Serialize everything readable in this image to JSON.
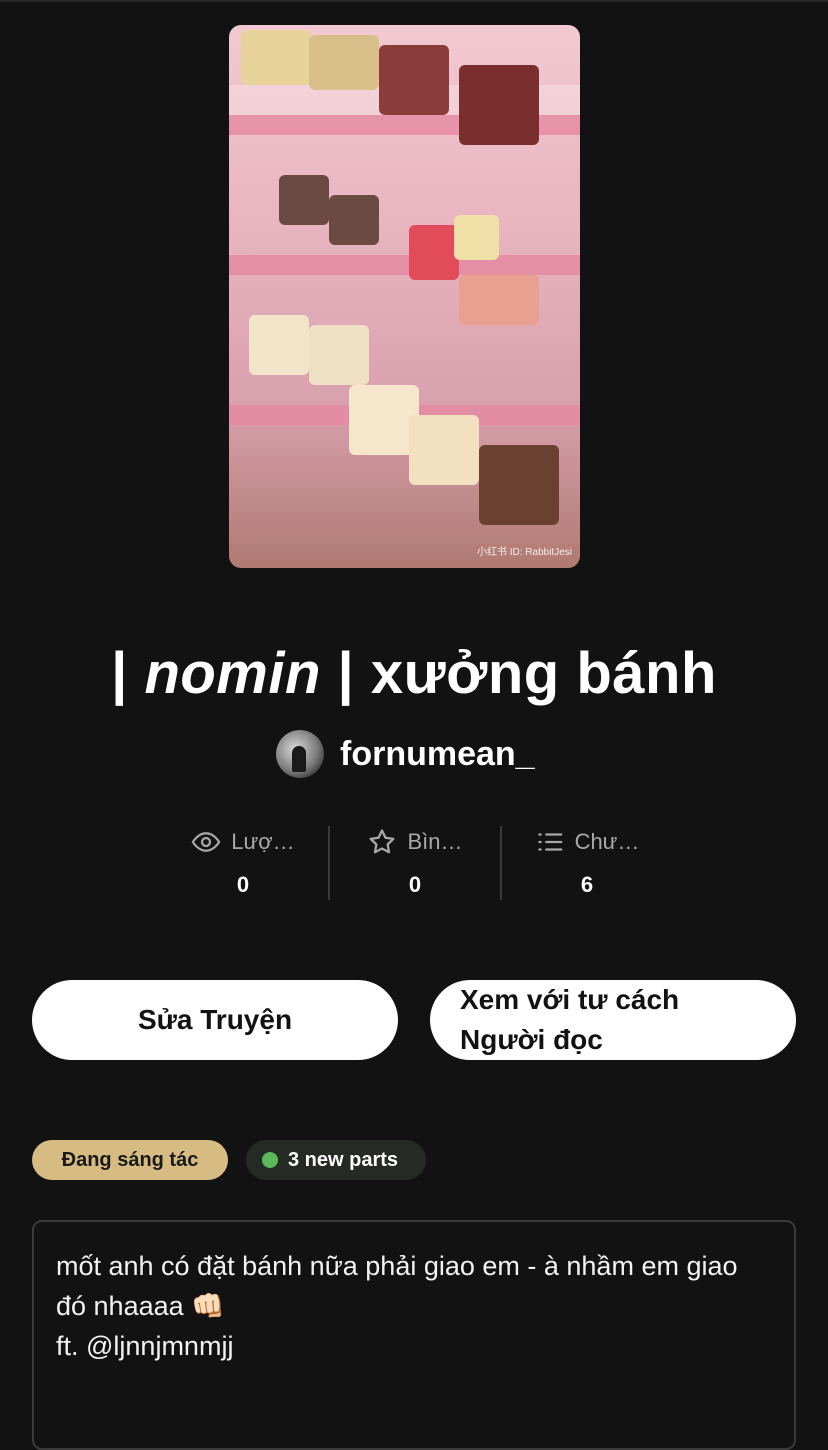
{
  "story": {
    "title_prefix": "| ",
    "title_italic": "nomin",
    "title_suffix": " | xưởng bánh",
    "author": "fornumean_",
    "cover_watermark": "小红书 ID: RabbitJesi"
  },
  "stats": [
    {
      "icon": "eye-icon",
      "label": "Lượ…",
      "value": "0"
    },
    {
      "icon": "star-icon",
      "label": "Bìn…",
      "value": "0"
    },
    {
      "icon": "list-icon",
      "label": "Chư…",
      "value": "6"
    }
  ],
  "buttons": {
    "edit": "Sửa Truyện",
    "read_as_reader": "Xem với tư cách Người đọc"
  },
  "tags": {
    "status": "Đang sáng tác",
    "new_parts": "3 new parts"
  },
  "description": "mốt anh có đặt bánh nữa phải giao em - à nhầm em giao đó nhaaaa 👊🏻\nft. @ljnnjmnmjj",
  "colors": {
    "background": "#121212",
    "status_pill": "#d6bc82",
    "new_dot": "#5cb85c"
  }
}
